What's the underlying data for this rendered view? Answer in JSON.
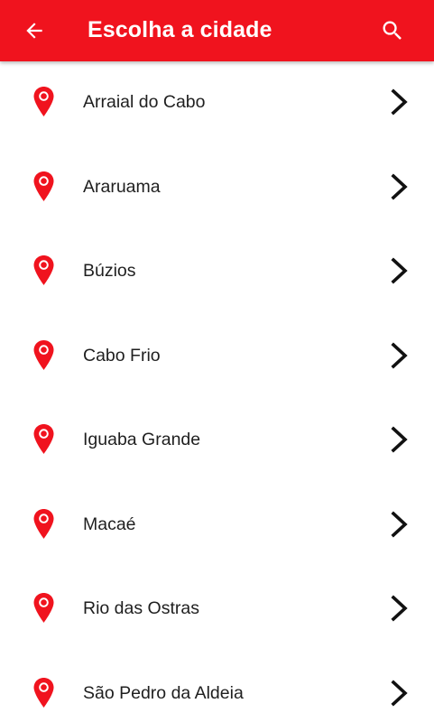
{
  "colors": {
    "accent": "#f0131e",
    "text": "#1f1f1f",
    "chevron": "#111111"
  },
  "toolbar": {
    "title": "Escolha a cidade",
    "back_icon": "arrow-left-icon",
    "search_icon": "search-icon"
  },
  "cities": [
    {
      "name": "Arraial do Cabo"
    },
    {
      "name": "Araruama"
    },
    {
      "name": "Búzios"
    },
    {
      "name": "Cabo Frio"
    },
    {
      "name": "Iguaba Grande"
    },
    {
      "name": "Macaé"
    },
    {
      "name": "Rio das Ostras"
    },
    {
      "name": "São Pedro da Aldeia"
    }
  ],
  "row_icons": {
    "leading": "map-pin-icon",
    "trailing": "chevron-right-icon"
  }
}
